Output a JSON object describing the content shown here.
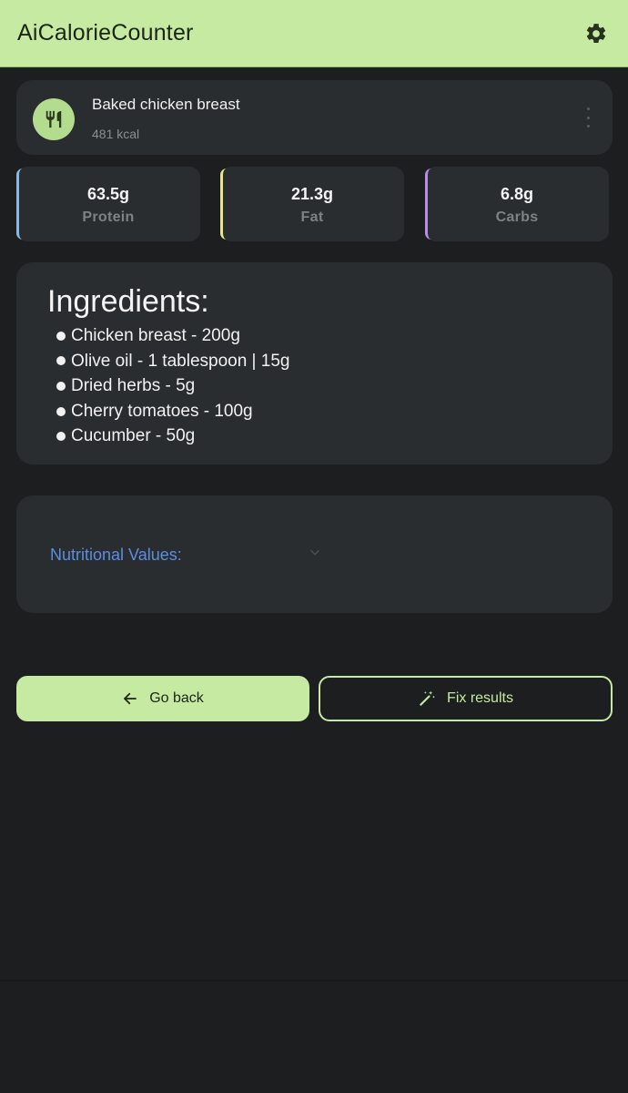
{
  "app": {
    "title": "AiCalorieCounter"
  },
  "meal": {
    "name": "Baked chicken breast",
    "kcal": "481 kcal"
  },
  "macros": [
    {
      "value": "63.5g",
      "label": "Protein",
      "color": "#8ab6e8"
    },
    {
      "value": "21.3g",
      "label": "Fat",
      "color": "#eae38a"
    },
    {
      "value": "6.8g",
      "label": "Carbs",
      "color": "#b98be4"
    }
  ],
  "ingredients": {
    "title": "Ingredients:",
    "items": [
      "Chicken breast - 200g",
      "Olive oil - 1 tablespoon | 15g",
      "Dried herbs - 5g",
      "Cherry tomatoes - 100g",
      "Cucumber - 50g"
    ]
  },
  "nutrition": {
    "label": "Nutritional Values:"
  },
  "actions": {
    "back_label": "Go back",
    "fix_label": "Fix results"
  },
  "colors": {
    "accent": "#c7eaa3",
    "background": "#1d1e1f",
    "card": "#2a2d2f",
    "link": "#5a8de2"
  }
}
